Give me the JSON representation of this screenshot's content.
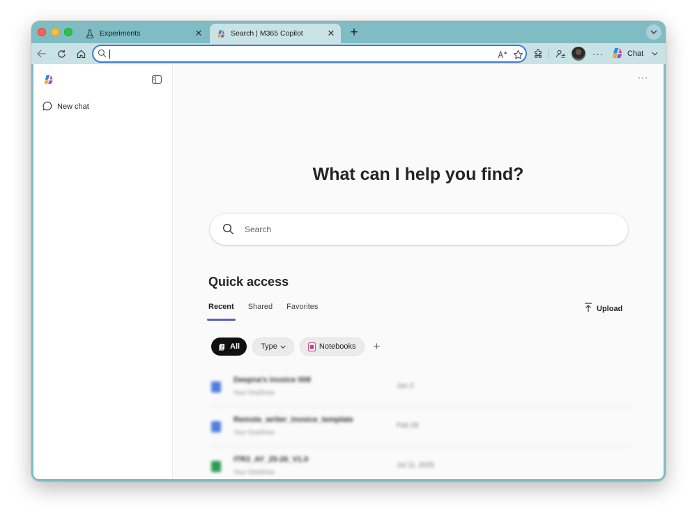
{
  "browser": {
    "tabs": [
      {
        "label": "Experiments",
        "icon": "flask-icon"
      },
      {
        "label": "Search | M365 Copilot",
        "icon": "copilot-icon",
        "active": true
      }
    ],
    "address_value": "",
    "chat_label": "Chat"
  },
  "sidebar": {
    "new_chat_label": "New chat"
  },
  "main": {
    "heading": "What can I help you find?",
    "search_placeholder": "Search",
    "quick_access_title": "Quick access",
    "tabs": [
      "Recent",
      "Shared",
      "Favorites"
    ],
    "active_tab": "Recent",
    "upload_label": "Upload",
    "filters": {
      "all_label": "All",
      "type_label": "Type",
      "notebooks_label": "Notebooks"
    },
    "files": [
      {
        "name": "Deepna's invoice 008",
        "location": "Your OneDrive",
        "date": "Jun 2",
        "color": "#4f7fe0"
      },
      {
        "name": "Remote_writer_invoice_template",
        "location": "Your OneDrive",
        "date": "Feb 28",
        "color": "#4f7fe0"
      },
      {
        "name": "ITR3_AY_25-26_V1.0",
        "location": "Your OneDrive",
        "date": "Jul 11, 2025",
        "color": "#2f9a52"
      }
    ]
  },
  "colors": {
    "accent": "#5b5fc7",
    "frame": "#7fbcc3",
    "toolbar": "#c9e2e5",
    "address_focus": "#3b7be0"
  }
}
